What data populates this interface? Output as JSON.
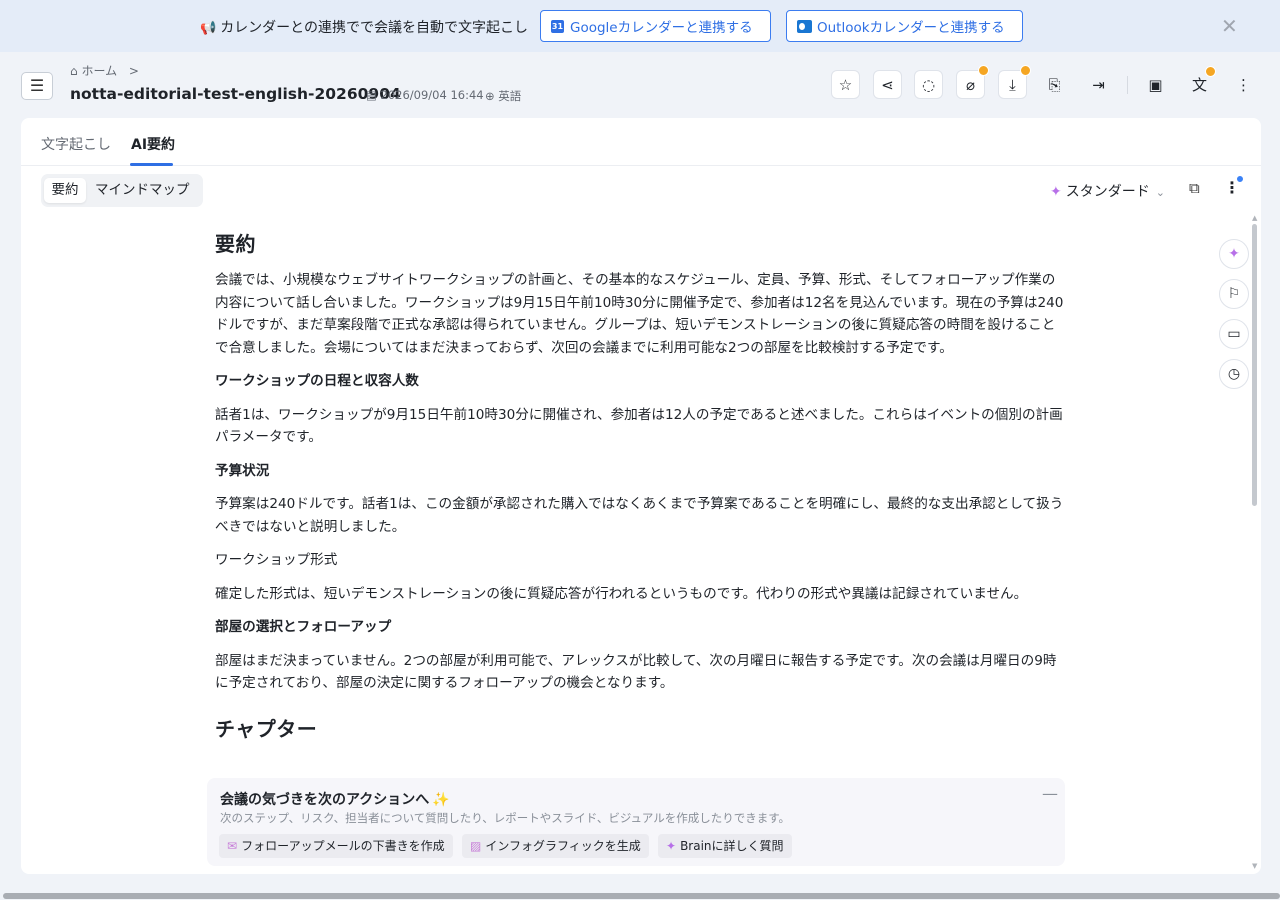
{
  "banner": {
    "text": "カレンダーとの連携でで会議を自動で文字起こし",
    "google_button": "Googleカレンダーと連携する",
    "outlook_button": "Outlookカレンダーと連携する",
    "close_icon": "close-icon"
  },
  "header": {
    "breadcrumb_home": "ホーム",
    "breadcrumb_sep": ">",
    "title": "notta-editorial-test-english-20260904",
    "date": "2026/09/04 16:44",
    "language": "英語",
    "toolbar_icons": [
      "star-icon",
      "share-icon",
      "search-icon",
      "attachment-icon",
      "download-icon",
      "export-icon",
      "move-icon",
      "save-icon",
      "translate-icon",
      "more-icon"
    ]
  },
  "tabs": {
    "transcript": "文字起こし",
    "ai_summary": "AI要約"
  },
  "view": {
    "summary": "要約",
    "mindmap": "マインドマップ",
    "template": "スタンダード"
  },
  "summary": {
    "heading": "要約",
    "intro": "会議では、小規模なウェブサイトワークショップの計画と、その基本的なスケジュール、定員、予算、形式、そしてフォローアップ作業の内容について話し合いました。ワークショップは9月15日午前10時30分に開催予定で、参加者は12名を見込んでいます。現在の予算は240ドルですが、まだ草案段階で正式な承認は得られていません。グループは、短いデモンストレーションの後に質疑応答の時間を設けることで合意しました。会場についてはまだ決まっておらず、次回の会議までに利用可能な2つの部屋を比較検討する予定です。",
    "sections": [
      {
        "title": "ワークショップの日程と収容人数",
        "bold": true,
        "body": "話者1は、ワークショップが9月15日午前10時30分に開催され、参加者は12人の予定であると述べました。これらはイベントの個別の計画パラメータです。"
      },
      {
        "title": "予算状況",
        "bold": true,
        "body": "予算案は240ドルです。話者1は、この金額が承認された購入ではなくあくまで予算案であることを明確にし、最終的な支出承認として扱うべきではないと説明しました。"
      },
      {
        "title": "ワークショップ形式",
        "bold": false,
        "body": "確定した形式は、短いデモンストレーションの後に質疑応答が行われるというものです。代わりの形式や異議は記録されていません。"
      },
      {
        "title": "部屋の選択とフォローアップ",
        "bold": true,
        "body": "部屋はまだ決まっていません。2つの部屋が利用可能で、アレックスが比較して、次の月曜日に報告する予定です。次の会議は月曜日の9時に予定されており、部屋の決定に関するフォローアップの機会となります。"
      }
    ],
    "chapter_heading": "チャプター"
  },
  "action_panel": {
    "title": "会議の気づきを次のアクションへ",
    "subtitle": "次のステップ、リスク、担当者について質問したり、レポートやスライド、ビジュアルを作成したりできます。",
    "chips": [
      "フォローアップメールの下書きを作成",
      "インフォグラフィックを生成",
      "Brainに詳しく質問"
    ]
  },
  "colors": {
    "accent": "#2f6fe4",
    "badge": "#f5a623",
    "background": "#f0f3f8"
  }
}
